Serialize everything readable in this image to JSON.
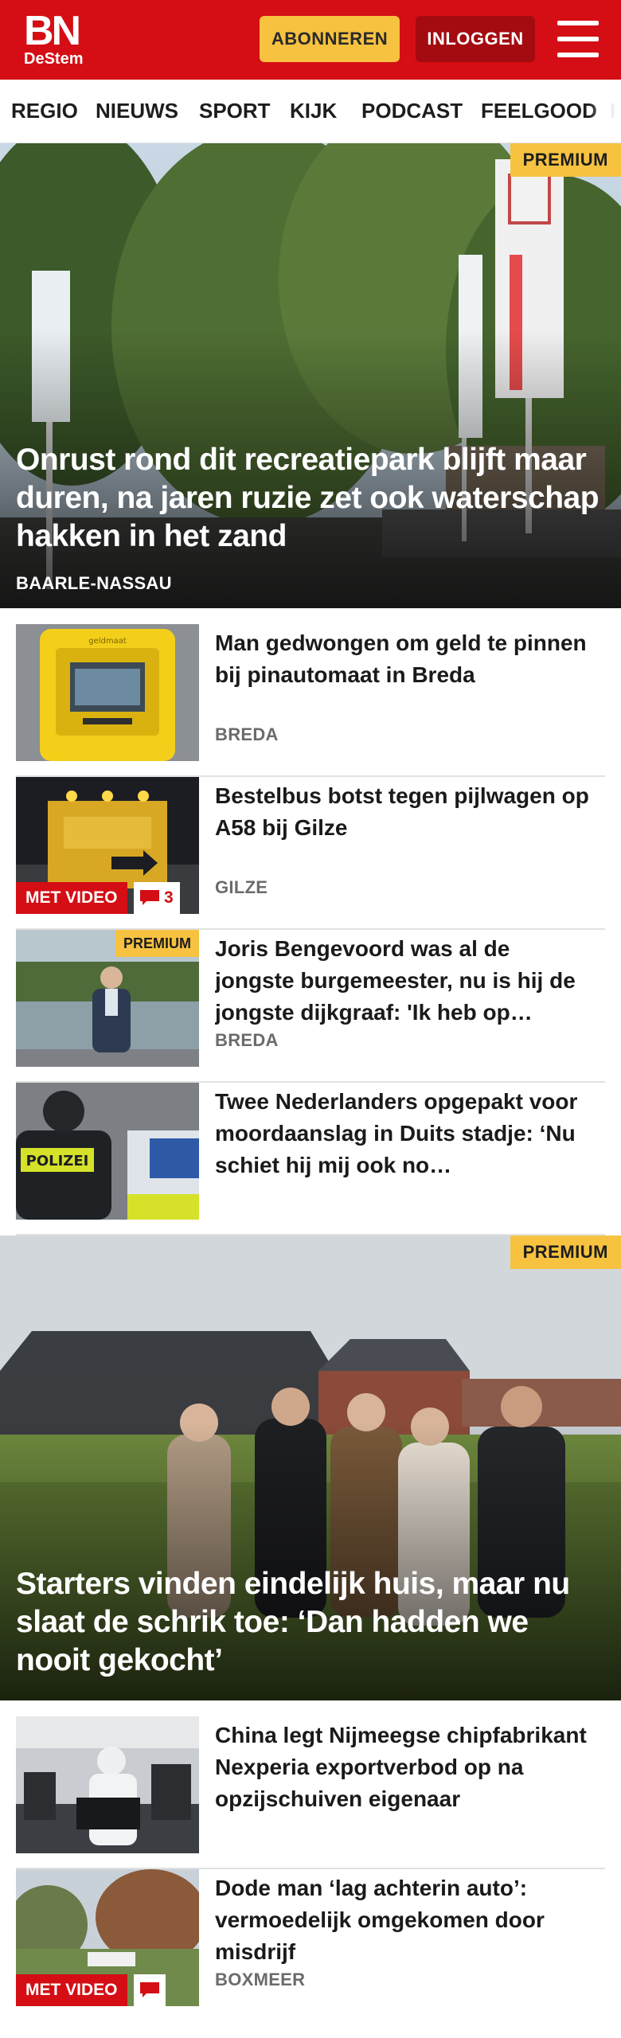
{
  "header": {
    "logo_main": "BN",
    "logo_sub": "DeStem",
    "subscribe_label": "ABONNEREN",
    "login_label": "INLOGGEN",
    "menu_icon": "hamburger-menu-icon"
  },
  "nav": {
    "items": [
      "REGIO",
      "NIEUWS",
      "SPORT",
      "KIJK",
      "PODCAST",
      "FEELGOOD"
    ]
  },
  "hero1": {
    "badge": "PREMIUM",
    "title": "Onrust rond dit recreatiepark blijft maar duren, na jaren ruzie zet ook waterschap hakken in het zand",
    "location": "BAARLE-NASSAU"
  },
  "articles1": [
    {
      "title": "Man gedwongen om geld te pinnen bij pinautomaat in Breda",
      "location": "BREDA"
    },
    {
      "title": "Bestelbus botst tegen pijlwagen op A58 bij Gilze",
      "location": "GILZE",
      "video_label": "MET VIDEO",
      "comments": "3"
    },
    {
      "badge": "PREMIUM",
      "title": "Joris Bengevoord was al de jongste burgemeester, nu is hij de jongste dijkgraaf: 'Ik heb op…",
      "location": "BREDA"
    },
    {
      "title": "Twee Nederlanders opgepakt voor moordaanslag in Duits stadje: ‘Nu schiet hij mij ook no…",
      "thumb_text": "POLIZEI"
    }
  ],
  "hero2": {
    "badge": "PREMIUM",
    "title": "Starters vinden eindelijk huis, maar nu slaat de schrik toe: ‘Dan hadden we nooit gekocht’"
  },
  "articles2": [
    {
      "title": "China legt Nijmeegse chipfabri­kant Nexperia exportverbod op na opzijschuiven eigenaar"
    },
    {
      "title": "Dode man ‘lag achterin auto’: vermoedelijk omgekomen door misdrijf",
      "location": "BOXMEER",
      "video_label": "MET VIDEO"
    }
  ],
  "colors": {
    "brand_red": "#d40e14",
    "premium_yellow": "#f6c23f",
    "login_dark_red": "#a30b10"
  }
}
